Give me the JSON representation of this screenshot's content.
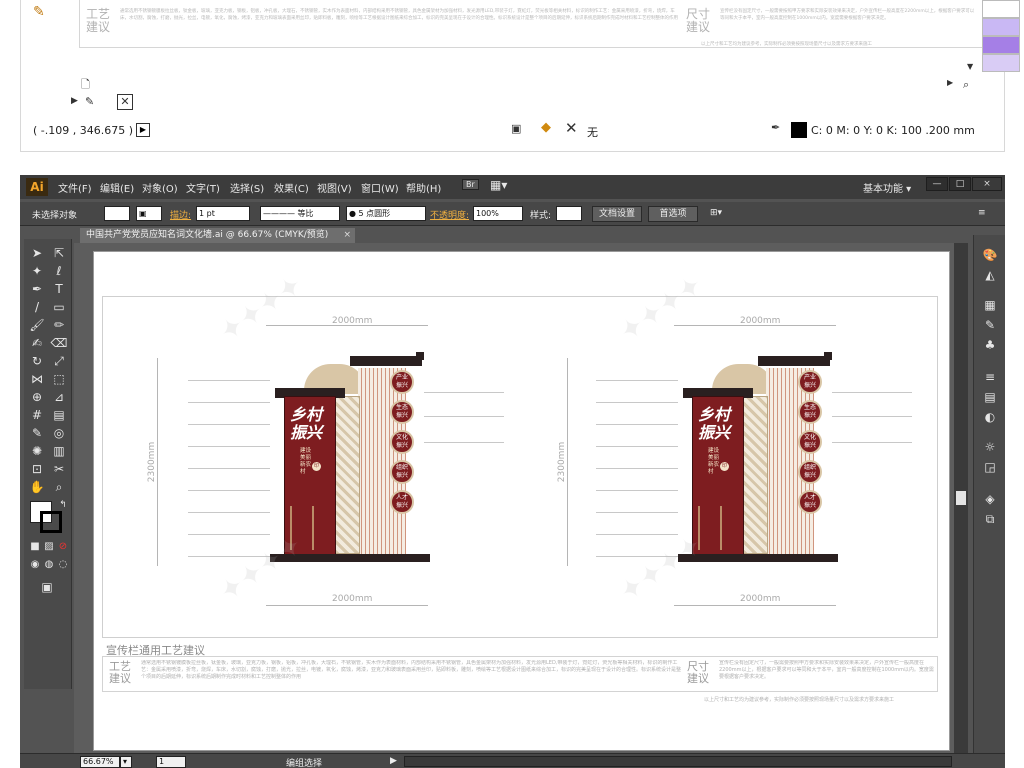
{
  "top_strip": {
    "labels": {
      "craft_left": "工艺\n建议",
      "size_right": "尺寸\n建议"
    },
    "fine_text_left": "通常选用不锈钢镀膜板拉丝板，钛金板，玻璃，亚克力板，钢板，铝板，冲孔板，大理石，不锈钢管，实木作为表面材料，内部结构采用不锈钢管，具色金属架材为加强材料，发光源用LED,带装于灯，霓虹灯，荧光板等相关材料，标识的制作工艺：金属采用喷漆，折弯，烧焊，车床，水切割，腐蚀，打磨，抛光，拉丝，电镀，氧化，腐蚀，烤漆，亚克力和玻璃表面采用丝印，贴即料板，雕刻，喷绘等工艺根据设计图纸来综合加工，标识的完美呈现在于设计的合理性。标识系统设计是整个项目的后期延伸，标识系统后期制作完成时材料和工艺控制整体的作用",
    "fine_text_right": "宣传栏没有固定尺寸，一般需要按照甲方要求和实际安装效果来决定，户外宣传栏一般高度在2200mm以上，根据客户要求可以等同和大于本平，室内一般高度控制在1000mm以内。宽度需要根据客户要求决定。",
    "footnote": "以上尺寸和工艺均为建议参考，实际制作必须要按照现场量尺寸以及需求方要求来施工",
    "swatch_colors": [
      "#ffffff",
      "#c9b8f4",
      "#a57fe6",
      "#d9ccf5"
    ],
    "coord": "( -.109 , 346.675 )",
    "none_label": "无",
    "color_readout": "C: 0 M: 0 Y: 0 K: 100  .200 mm"
  },
  "menubar": {
    "logo": "Ai",
    "items": [
      "文件(F)",
      "编辑(E)",
      "对象(O)",
      "文字(T)",
      "选择(S)",
      "效果(C)",
      "视图(V)",
      "窗口(W)",
      "帮助(H)"
    ],
    "bridge_icon": "Br",
    "workspace": "基本功能 ▾",
    "window_controls": [
      "—",
      "□",
      "×"
    ]
  },
  "controlbar": {
    "selection": "未选择对象",
    "stroke_label": "描边:",
    "stroke_value": "1 pt",
    "stroke_style": "等比",
    "brush": "5 点圆形",
    "opacity_label": "不透明度:",
    "opacity_value": "100%",
    "style_label": "样式:",
    "doc_settings": "文档设置",
    "preferences": "首选项"
  },
  "document_tab": {
    "title": "中国共产党党员应知名词文化墙.ai @ 66.67% (CMYK/预览)",
    "close": "×"
  },
  "artboard": {
    "dim_width_top": "2000mm",
    "dim_width_bottom": "2000mm",
    "dim_height": "2300mm",
    "caption": "宣传栏通用工艺建议",
    "craft_label": "工艺\n建议",
    "size_label": "尺寸\n建议",
    "spec_left": "通常选用不锈钢镀膜板拉丝板，钛金板，玻璃，亚克力板，钢板，铝板，冲孔板，大理石，不锈钢管，实木作为表面材料，内部结构采用不锈钢管，具色金属架材为加强材料，发光源用LED,带装于灯，霓虹灯，荧光板等相关材料，标识的制作工艺：金属采用喷漆，折弯，烧焊，车床，水切割，腐蚀，打磨，抛光，拉丝，电镀，氧化，腐蚀，烤漆，亚克力和玻璃表面采用丝印，贴即料板，雕刻，喷绘等工艺根据设计图纸来综合加工，标识的完美呈现在于设计的合理性。标识系统设计是整个项目的后期延伸，标识系统后期制作完成时材料和工艺控制整体的作用",
    "spec_right": "宣传栏没有固定尺寸，一般需要按照甲方要求和实际安装效果来决定，户外宣传栏一般高度在2200mm以上，根据客户要求可以等同和大于本平，室内一般高度控制在1000mm以内。宽度需要根据客户要求决定。",
    "footnote": "以上尺寸和工艺均为建议参考，实际制作必须要按照现场量尺寸以及需求方要求来施工",
    "sign_title": "乡村振兴",
    "sign_subtitle": "建设美丽新农村",
    "badges": [
      "产业\n振兴",
      "生态\n振兴",
      "文化\n振兴",
      "组织\n振兴",
      "人才\n振兴"
    ]
  },
  "statusbar": {
    "zoom": "66.67%",
    "page": "1",
    "mode": "编组选择"
  }
}
